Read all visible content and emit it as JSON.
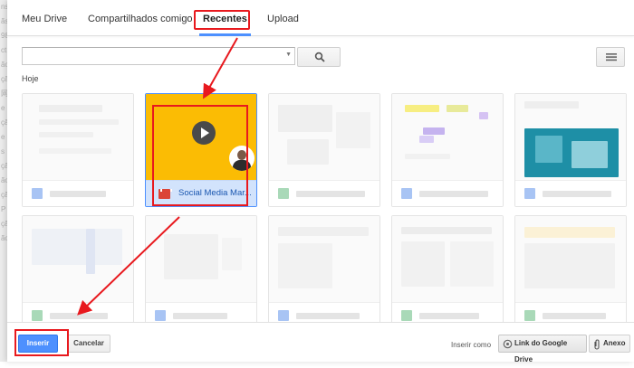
{
  "tabs": [
    {
      "label": "Meu Drive",
      "active": false
    },
    {
      "label": "Compartilhados comigo",
      "active": false
    },
    {
      "label": "Recentes",
      "active": true
    },
    {
      "label": "Upload",
      "active": false
    }
  ],
  "search": {
    "value": "",
    "placeholder": ""
  },
  "section": {
    "label": "Hoje"
  },
  "selected_file": {
    "name": "Social Media Mar...",
    "type_icon": "video-icon"
  },
  "bottom": {
    "insert_label": "Inserir",
    "cancel_label": "Cancelar",
    "insert_as_label": "Inserir como",
    "link_label": "Link do Google Drive",
    "attach_label": "Anexo"
  },
  "colors": {
    "accent": "#4d90fe",
    "highlight": "#e8191e",
    "selected_thumb": "#fbbc04"
  }
}
